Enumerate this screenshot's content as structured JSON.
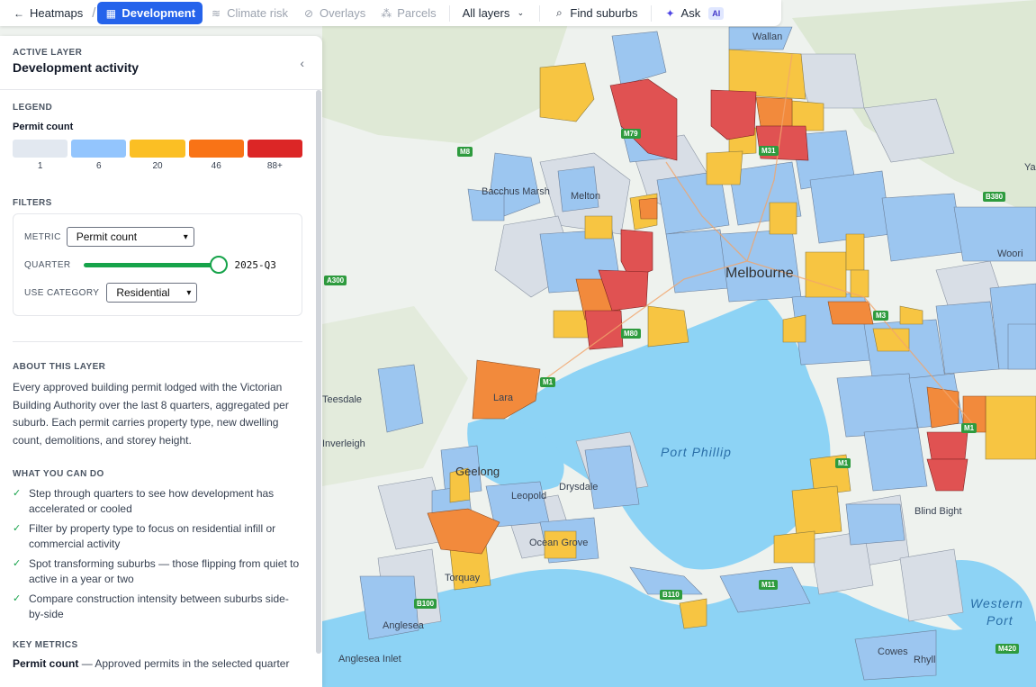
{
  "toolbar": {
    "back_label": "Heatmaps",
    "separator": "/",
    "tabs": [
      {
        "label": "Development",
        "icon": "building-icon",
        "active": true
      },
      {
        "label": "Climate risk",
        "icon": "waves-icon",
        "active": false
      },
      {
        "label": "Overlays",
        "icon": "slash-circle-icon",
        "active": false
      },
      {
        "label": "Parcels",
        "icon": "shapes-icon",
        "active": false
      }
    ],
    "layers_label": "All layers",
    "find_label": "Find suburbs",
    "ask_label": "Ask",
    "ai_badge": "AI"
  },
  "panel": {
    "eyebrow": "ACTIVE LAYER",
    "title": "Development activity",
    "legend": {
      "heading": "LEGEND",
      "subtitle": "Permit count",
      "stops": [
        {
          "label": "1",
          "color": "#e2e8f0"
        },
        {
          "label": "6",
          "color": "#93c5fd"
        },
        {
          "label": "20",
          "color": "#fbbf24"
        },
        {
          "label": "46",
          "color": "#f97316"
        },
        {
          "label": "88+",
          "color": "#dc2626"
        }
      ]
    },
    "filters": {
      "heading": "FILTERS",
      "metric_label": "METRIC",
      "metric_value": "Permit count",
      "quarter_label": "QUARTER",
      "quarter_value": "2025-Q3",
      "quarter_position": 1.0,
      "use_label": "USE CATEGORY",
      "use_value": "Residential"
    },
    "about": {
      "heading": "ABOUT THIS LAYER",
      "text": "Every approved building permit lodged with the Victorian Building Authority over the last 8 quarters, aggregated per suburb. Each permit carries property type, new dwelling count, demolitions, and storey height."
    },
    "can_do": {
      "heading": "WHAT YOU CAN DO",
      "items": [
        "Step through quarters to see how development has accelerated or cooled",
        "Filter by property type to focus on residential infill or commercial activity",
        "Spot transforming suburbs — those flipping from quiet to active in a year or two",
        "Compare construction intensity between suburbs side-by-side"
      ]
    },
    "metrics": {
      "heading": "KEY METRICS",
      "name": "Permit count",
      "desc": "— Approved permits in the selected quarter"
    }
  },
  "map": {
    "labels": [
      {
        "text": "Wallan",
        "kind": "town"
      },
      {
        "text": "Bacchus Marsh",
        "kind": "town"
      },
      {
        "text": "Melton",
        "kind": "town"
      },
      {
        "text": "Melbourne",
        "kind": "city"
      },
      {
        "text": "Lara",
        "kind": "town"
      },
      {
        "text": "Geelong",
        "kind": "city"
      },
      {
        "text": "Drysdale",
        "kind": "town"
      },
      {
        "text": "Leopold",
        "kind": "town"
      },
      {
        "text": "Ocean Grove",
        "kind": "town"
      },
      {
        "text": "Torquay",
        "kind": "town"
      },
      {
        "text": "Anglesea",
        "kind": "town"
      },
      {
        "text": "Port Phillip",
        "kind": "water"
      },
      {
        "text": "Blind Bight",
        "kind": "town"
      },
      {
        "text": "Western",
        "kind": "water"
      },
      {
        "text": "Port",
        "kind": "water"
      },
      {
        "text": "Cowes",
        "kind": "town"
      },
      {
        "text": "Rhyll",
        "kind": "town"
      },
      {
        "text": "Inverleigh",
        "kind": "town"
      },
      {
        "text": "Teesdale",
        "kind": "town"
      },
      {
        "text": "Woori",
        "kind": "town"
      },
      {
        "text": "Yarra",
        "kind": "town"
      },
      {
        "text": "Anglesea Inlet",
        "kind": "town"
      }
    ],
    "roads": [
      "M79",
      "M8",
      "M31",
      "M1",
      "A300",
      "M80",
      "M3",
      "B380",
      "M1",
      "M11",
      "M420",
      "B100",
      "M1",
      "B110"
    ]
  }
}
